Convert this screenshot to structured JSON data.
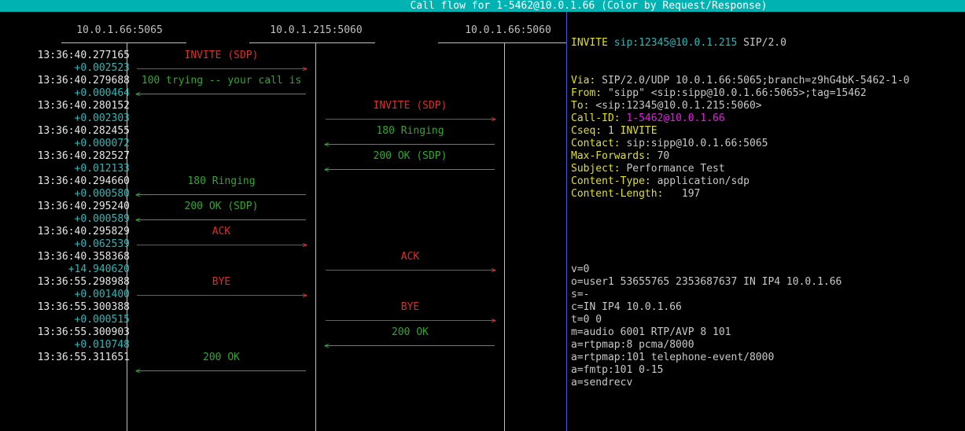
{
  "title": "Call flow for 1-5462@10.0.1.66 (Color by Request/Response)",
  "columns": [
    "10.0.1.66:5065",
    "10.0.1.215:5060",
    "10.0.1.66:5060"
  ],
  "flows": [
    {
      "time": "13:36:40.277165",
      "delta": "+0.002523",
      "label": "INVITE (SDP)",
      "kind": "req",
      "lane": "a",
      "dir": "right"
    },
    {
      "time": "13:36:40.279688",
      "delta": "+0.000464",
      "label": "100 trying -- your call is",
      "kind": "resp",
      "lane": "a",
      "dir": "left"
    },
    {
      "time": "13:36:40.280152",
      "delta": "+0.002303",
      "label": "INVITE (SDP)",
      "kind": "req",
      "lane": "b",
      "dir": "right"
    },
    {
      "time": "13:36:40.282455",
      "delta": "+0.000072",
      "label": "180 Ringing",
      "kind": "resp",
      "lane": "b",
      "dir": "left"
    },
    {
      "time": "13:36:40.282527",
      "delta": "+0.012133",
      "label": "200 OK (SDP)",
      "kind": "resp",
      "lane": "b",
      "dir": "left"
    },
    {
      "time": "13:36:40.294660",
      "delta": "+0.000580",
      "label": "180 Ringing",
      "kind": "resp",
      "lane": "a",
      "dir": "left"
    },
    {
      "time": "13:36:40.295240",
      "delta": "+0.000589",
      "label": "200 OK (SDP)",
      "kind": "resp",
      "lane": "a",
      "dir": "left"
    },
    {
      "time": "13:36:40.295829",
      "delta": "+0.062539",
      "label": "ACK",
      "kind": "req",
      "lane": "a",
      "dir": "right"
    },
    {
      "time": "13:36:40.358368",
      "delta": "+14.940620",
      "label": "ACK",
      "kind": "req",
      "lane": "b",
      "dir": "right"
    },
    {
      "time": "13:36:55.298988",
      "delta": "+0.001400",
      "label": "BYE",
      "kind": "req",
      "lane": "a",
      "dir": "right"
    },
    {
      "time": "13:36:55.300388",
      "delta": "+0.000515",
      "label": "BYE",
      "kind": "req",
      "lane": "b",
      "dir": "right"
    },
    {
      "time": "13:36:55.300903",
      "delta": "+0.010748",
      "label": "200 OK",
      "kind": "resp",
      "lane": "b",
      "dir": "left"
    },
    {
      "time": "13:36:55.311651",
      "delta": "",
      "label": "200 OK",
      "kind": "resp",
      "lane": "a",
      "dir": "left"
    }
  ],
  "message": {
    "request_line": {
      "method": "INVITE",
      "uri": "sip:12345@10.0.1.215",
      "version": "SIP/2.0"
    },
    "headers": [
      {
        "name": "Via:",
        "value": "SIP/2.0/UDP 10.0.1.66:5065;branch=z9hG4bK-5462-1-0"
      },
      {
        "name": "From:",
        "value": "\"sipp\" <sip:sipp@10.0.1.66:5065>;tag=15462"
      },
      {
        "name": "To:",
        "value": "<sip:12345@10.0.1.215:5060>"
      },
      {
        "name": "Call-ID:",
        "value": "1-5462@10.0.1.66",
        "highlight": "magenta"
      },
      {
        "name": "Cseq:",
        "value": "1",
        "extra": "INVITE"
      },
      {
        "name": "Contact:",
        "value": "sip:sipp@10.0.1.66:5065"
      },
      {
        "name": "Max-Forwards:",
        "value": "70"
      },
      {
        "name": "Subject:",
        "value": "Performance Test"
      },
      {
        "name": "Content-Type:",
        "value": "application/sdp"
      },
      {
        "name": "Content-Length:",
        "value": "  197"
      }
    ],
    "sdp": [
      "v=0",
      "o=user1 53655765 2353687637 IN IP4 10.0.1.66",
      "s=-",
      "c=IN IP4 10.0.1.66",
      "t=0 0",
      "m=audio 6001 RTP/AVP 8 101",
      "a=rtpmap:8 pcma/8000",
      "a=rtpmap:101 telephone-event/8000",
      "a=fmtp:101 0-15",
      "a=sendrecv"
    ]
  },
  "colors": {
    "request": "#d9302a",
    "response": "#2fa82f",
    "title_bar": "#00b3b3",
    "delta": "#2bb8b8",
    "separator": "#3b5bd8"
  }
}
